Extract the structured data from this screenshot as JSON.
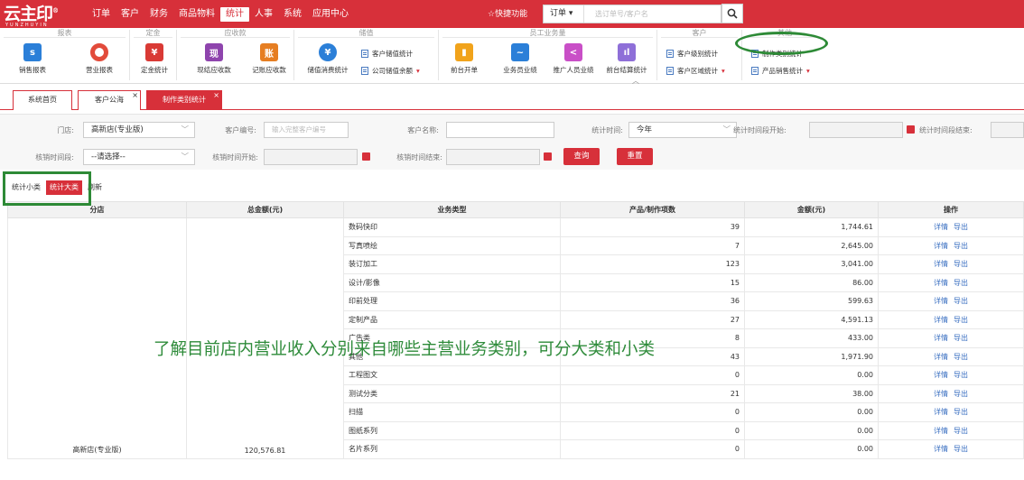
{
  "brand": {
    "logo_text": "云主印",
    "logo_sub": "YUNZHUYIN",
    "reg": "®"
  },
  "nav": [
    "订单",
    "客户",
    "财务",
    "商品物料",
    "统计",
    "人事",
    "系统",
    "应用中心"
  ],
  "nav_active": "统计",
  "quick": "☆快捷功能",
  "search": {
    "select": "订单",
    "placeholder": "选订单号/客户名"
  },
  "ribbon": {
    "groups": [
      "报表",
      "定金",
      "应收款",
      "储值",
      "员工业务量",
      "客户",
      "其他"
    ],
    "items": [
      "销售报表",
      "营业报表",
      "定金统计",
      "现结应收款",
      "记账应收款",
      "储值消费统计",
      "前台开单",
      "业务员业绩",
      "推广人员业绩",
      "前台结算统计"
    ],
    "rows": [
      "客户储值统计",
      "公司储值余额",
      "客户级别统计",
      "客户区域统计",
      "制作类别统计",
      "产品销售统计"
    ]
  },
  "tabs": [
    "系统首页",
    "客户公海",
    "制作类别统计"
  ],
  "filters": {
    "store_label": "门店:",
    "store_value": "高新店(专业版)",
    "cust_no_label": "客户编号:",
    "cust_no_ph": "输入完整客户编号",
    "cust_name_label": "客户名称:",
    "stat_time_label": "统计时间:",
    "stat_time_value": "今年",
    "stat_start_label": "统计时间段开始:",
    "stat_end_label": "统计时间段结束:",
    "writeoff_label": "核销时间段:",
    "writeoff_value": "--请选择--",
    "writeoff_start_label": "核销时间开始:",
    "writeoff_end_label": "核销时间结束:",
    "query": "查询",
    "reset": "重置"
  },
  "toggles": {
    "small": "统计小类",
    "big": "统计大类",
    "refresh": "刷新"
  },
  "table": {
    "headers": [
      "分店",
      "总金额(元)",
      "业务类型",
      "产品/制作项数",
      "金额(元)",
      "操作"
    ],
    "store": "高新店(专业版)",
    "total": "120,576.81",
    "rows": [
      {
        "type": "数码快印",
        "count": "39",
        "amount": "1,744.61"
      },
      {
        "type": "写真喷绘",
        "count": "7",
        "amount": "2,645.00"
      },
      {
        "type": "装订加工",
        "count": "123",
        "amount": "3,041.00"
      },
      {
        "type": "设计/影像",
        "count": "15",
        "amount": "86.00"
      },
      {
        "type": "印前处理",
        "count": "36",
        "amount": "599.63"
      },
      {
        "type": "定制产品",
        "count": "27",
        "amount": "4,591.13"
      },
      {
        "type": "广告类",
        "count": "8",
        "amount": "433.00"
      },
      {
        "type": "其他",
        "count": "43",
        "amount": "1,971.90"
      },
      {
        "type": "工程图文",
        "count": "0",
        "amount": "0.00"
      },
      {
        "type": "测试分类",
        "count": "21",
        "amount": "38.00"
      },
      {
        "type": "扫描",
        "count": "0",
        "amount": "0.00"
      },
      {
        "type": "图纸系列",
        "count": "0",
        "amount": "0.00"
      },
      {
        "type": "名片系列",
        "count": "0",
        "amount": "0.00"
      }
    ],
    "detail": "详情",
    "export": "导出"
  },
  "annotation": "了解目前店内营业收入分别来自哪些主营业务类别，可分大类和小类",
  "colors": {
    "brand": "#d7303a",
    "annotation": "#2d8a36",
    "link": "#3a6fc1"
  }
}
